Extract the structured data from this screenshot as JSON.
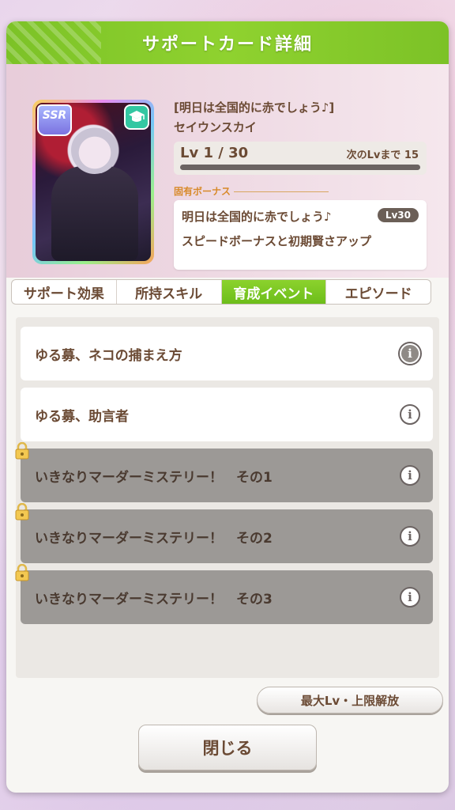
{
  "dialog": {
    "title": "サポートカード詳細"
  },
  "card": {
    "rarity": "SSR",
    "type_icon": "mortarboard-icon",
    "title": "[明日は全国的に赤でしょう♪]",
    "character": "セイウンスカイ",
    "level_text": "Lv 1 / 30",
    "next_level_text": "次のLvまで 15",
    "level_progress": 0.0
  },
  "unique_bonus": {
    "label": "固有ボーナス",
    "name": "明日は全国的に赤でしょう♪",
    "level": "Lv30",
    "description": "スピードボーナスと初期賢さアップ"
  },
  "tabs": [
    {
      "label": "サポート効果",
      "active": false
    },
    {
      "label": "所持スキル",
      "active": false
    },
    {
      "label": "育成イベント",
      "active": true
    },
    {
      "label": "エピソード",
      "active": false
    }
  ],
  "events": [
    {
      "title": "ゆる募、ネコの捕まえ方",
      "locked": false
    },
    {
      "title": "ゆる募、助言者",
      "locked": false
    },
    {
      "title": "いきなりマーダーミステリー！　その1",
      "locked": true
    },
    {
      "title": "いきなりマーダーミステリー！　その2",
      "locked": true
    },
    {
      "title": "いきなりマーダーミステリー！　その3",
      "locked": true
    }
  ],
  "buttons": {
    "limit_break": "最大Lv・上限解放",
    "close": "閉じる"
  },
  "colors": {
    "header_green": "#8fd22f",
    "text_brown": "#6b4a34",
    "locked_gray": "#9c9996"
  }
}
